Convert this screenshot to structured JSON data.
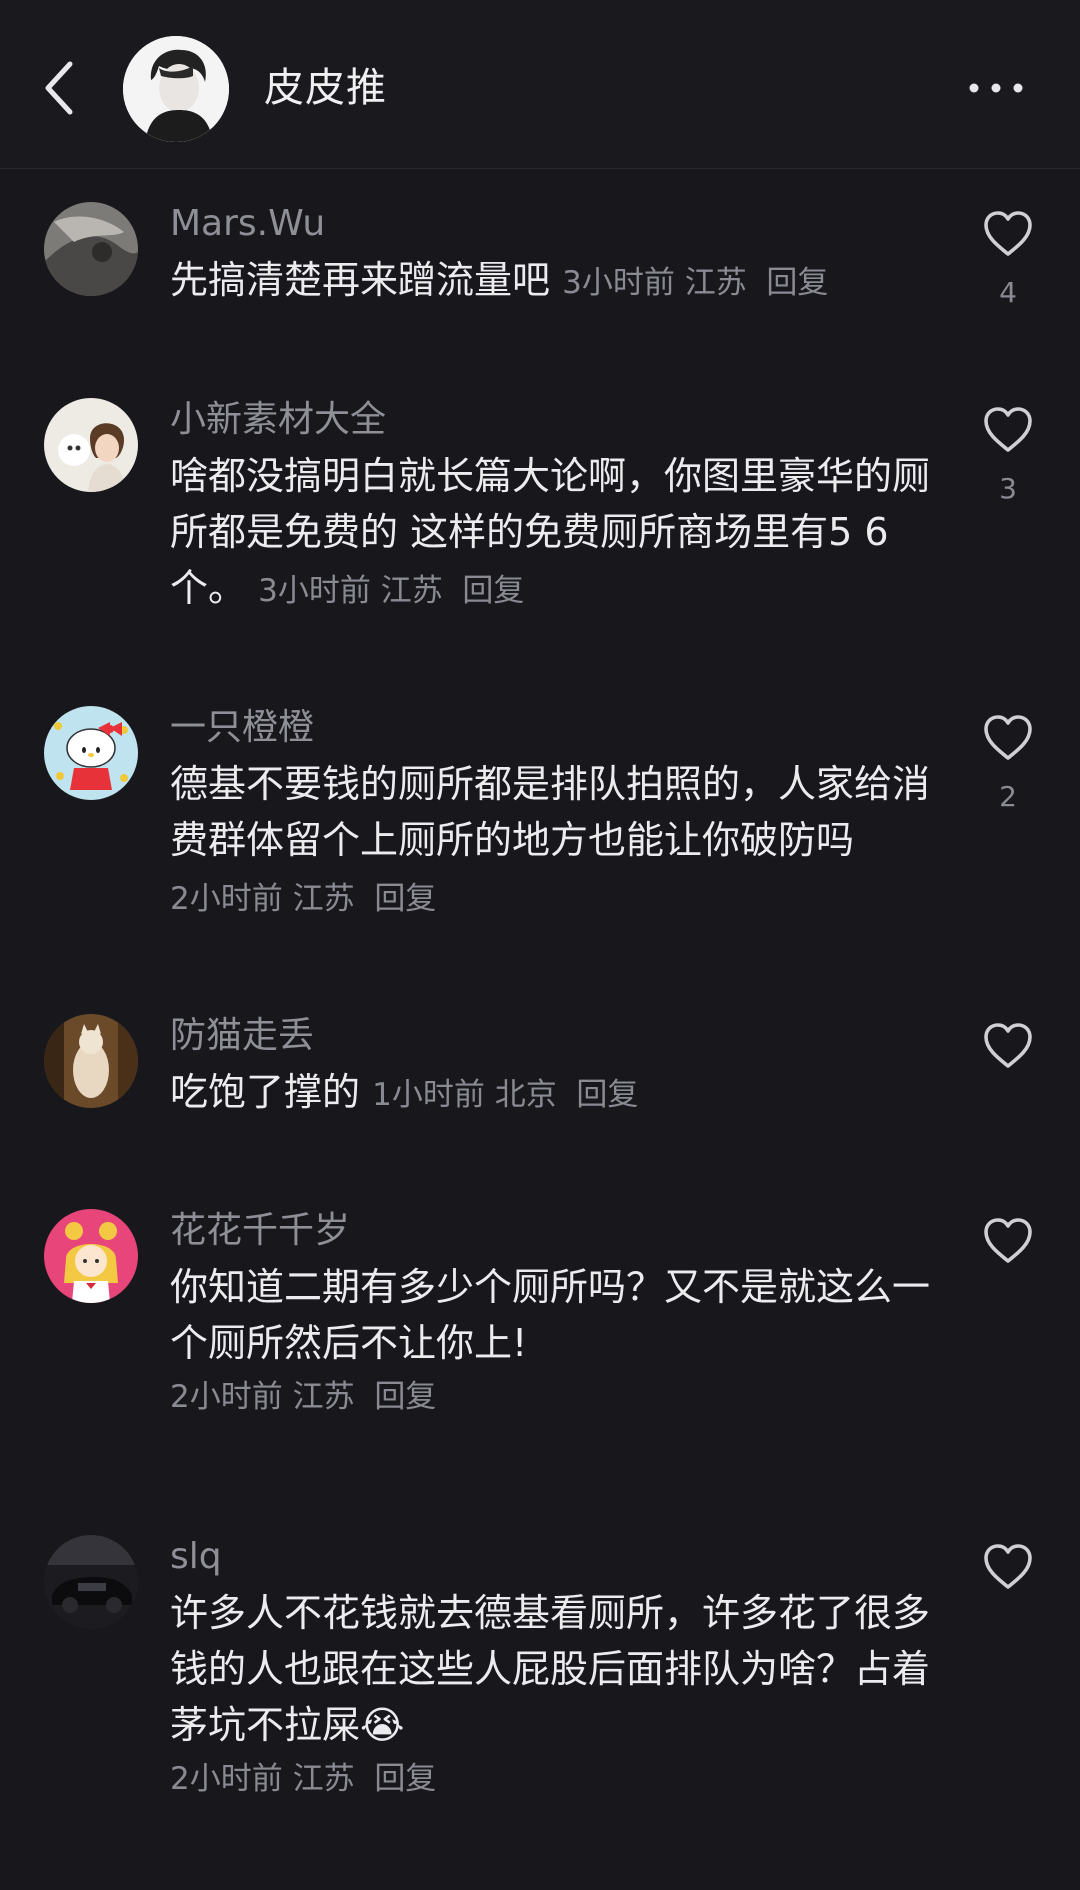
{
  "header": {
    "title": "皮皮推",
    "back_icon": "chevron-left-icon",
    "more_icon": "more-horizontal-icon"
  },
  "comments": [
    {
      "user": "Mars.Wu",
      "text": "先搞清楚再来蹭流量吧",
      "time": "3小时前",
      "location": "江苏",
      "reply": "回复",
      "likes": "4"
    },
    {
      "user": "小新素材大全",
      "text": "啥都没搞明白就长篇大论啊，你图里豪华的厕所都是免费的 这样的免费厕所商场里有5 6个。",
      "time": "3小时前",
      "location": "江苏",
      "reply": "回复",
      "likes": "3"
    },
    {
      "user": "一只橙橙",
      "text": "德基不要钱的厕所都是排队拍照的，人家给消费群体留个上厕所的地方也能让你破防吗",
      "time": "2小时前",
      "location": "江苏",
      "reply": "回复",
      "likes": "2"
    },
    {
      "user": "防猫走丢",
      "text": "吃饱了撑的",
      "time": "1小时前",
      "location": "北京",
      "reply": "回复",
      "likes": ""
    },
    {
      "user": "花花千千岁",
      "text": "你知道二期有多少个厕所吗？又不是就这么一个厕所然后不让你上!",
      "time": "2小时前",
      "location": "江苏",
      "reply": "回复",
      "likes": ""
    },
    {
      "user": "slq",
      "text": "许多人不花钱就去德基看厕所，许多花了很多钱的人也跟在这些人屁股后面排队为啥？占着茅坑不拉屎",
      "emoji": "😭",
      "time": "2小时前",
      "location": "江苏",
      "reply": "回复",
      "likes": ""
    }
  ],
  "icons": {
    "like": "heart-outline-icon"
  },
  "colors": {
    "background": "#17171c",
    "text": "#ececef",
    "muted": "#8a8a93"
  }
}
